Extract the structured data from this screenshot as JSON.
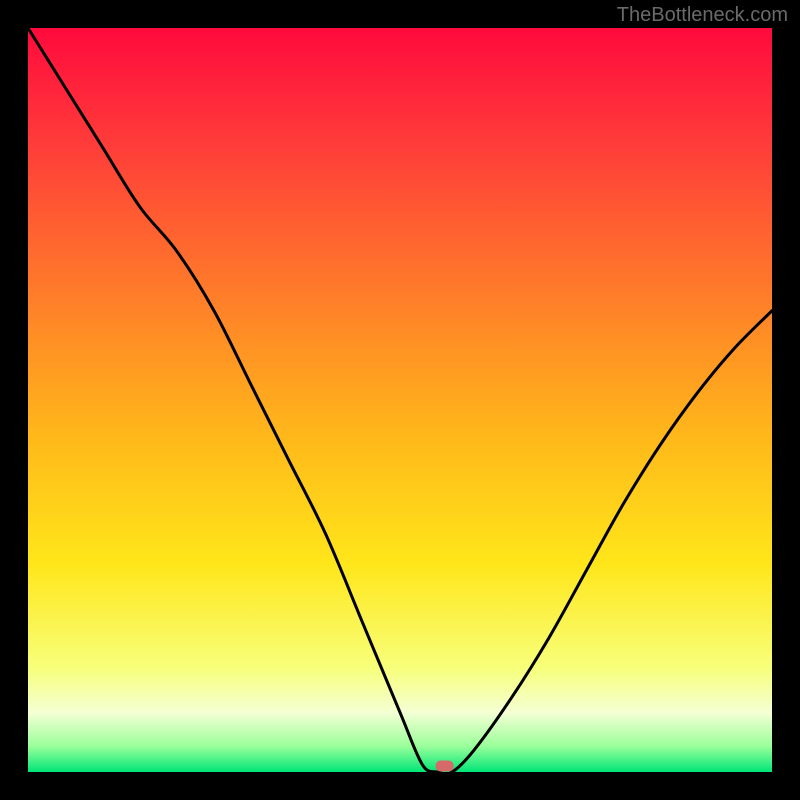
{
  "watermark": "TheBottleneck.com",
  "chart_data": {
    "type": "line",
    "title": "",
    "xlabel": "",
    "ylabel": "",
    "xlim": [
      0,
      100
    ],
    "ylim": [
      0,
      100
    ],
    "x": [
      0,
      5,
      10,
      15,
      20,
      25,
      30,
      35,
      40,
      45,
      50,
      53,
      55,
      57,
      60,
      65,
      70,
      75,
      80,
      85,
      90,
      95,
      100
    ],
    "y": [
      100,
      92,
      84,
      76,
      70,
      62,
      52,
      42,
      32,
      20,
      8,
      1,
      0,
      0,
      3,
      10,
      18,
      27,
      36,
      44,
      51,
      57,
      62
    ],
    "series_name": "bottleneck",
    "annotations": [],
    "marker": {
      "x": 56,
      "y": 0.8,
      "color": "#d46a6a"
    },
    "gradient_stops": [
      {
        "offset": 0.0,
        "color": "#ff0a3c"
      },
      {
        "offset": 0.15,
        "color": "#ff3a3a"
      },
      {
        "offset": 0.35,
        "color": "#ff7a2a"
      },
      {
        "offset": 0.55,
        "color": "#ffb81a"
      },
      {
        "offset": 0.72,
        "color": "#ffe61a"
      },
      {
        "offset": 0.86,
        "color": "#f7ff7a"
      },
      {
        "offset": 0.92,
        "color": "#f4ffd4"
      },
      {
        "offset": 0.965,
        "color": "#9bff9b"
      },
      {
        "offset": 1.0,
        "color": "#00e676"
      }
    ]
  }
}
